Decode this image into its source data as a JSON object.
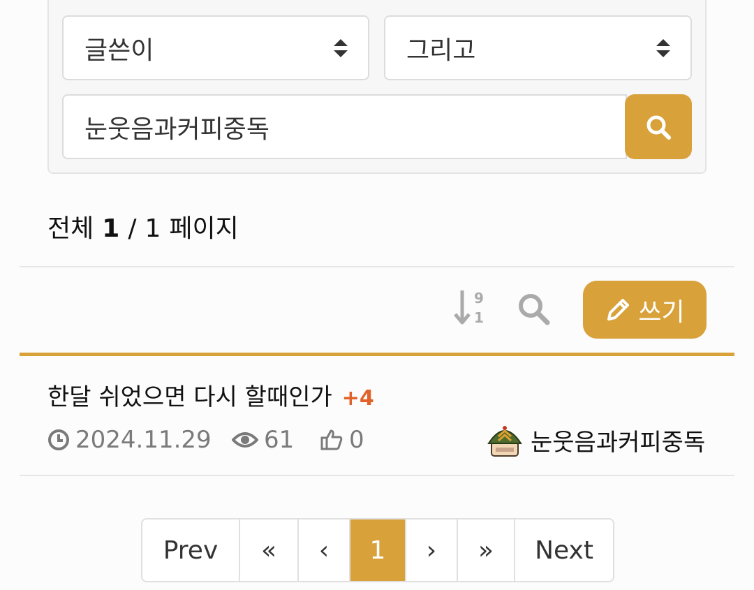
{
  "search": {
    "field_select": "글쓴이",
    "operator_select": "그리고",
    "query_value": "눈웃음과커피중독"
  },
  "summary": {
    "prefix": "전체",
    "current_page": "1",
    "separator": "/",
    "total_pages": "1",
    "suffix": "페이지"
  },
  "toolbar": {
    "sort_icon": "sort-numeric-desc-icon",
    "search_icon": "search-icon",
    "write_label": "쓰기"
  },
  "posts": [
    {
      "title": "한달 쉬었으면 다시 할때인가",
      "comment_count": "+4",
      "date": "2024.11.29",
      "views": "61",
      "likes": "0",
      "author": "눈웃음과커피중독"
    }
  ],
  "pagination": {
    "prev": "Prev",
    "first": "«",
    "previous": "‹",
    "current": "1",
    "following": "›",
    "last": "»",
    "next": "Next"
  },
  "colors": {
    "accent": "#d8a13a",
    "comment": "#e0622a"
  }
}
